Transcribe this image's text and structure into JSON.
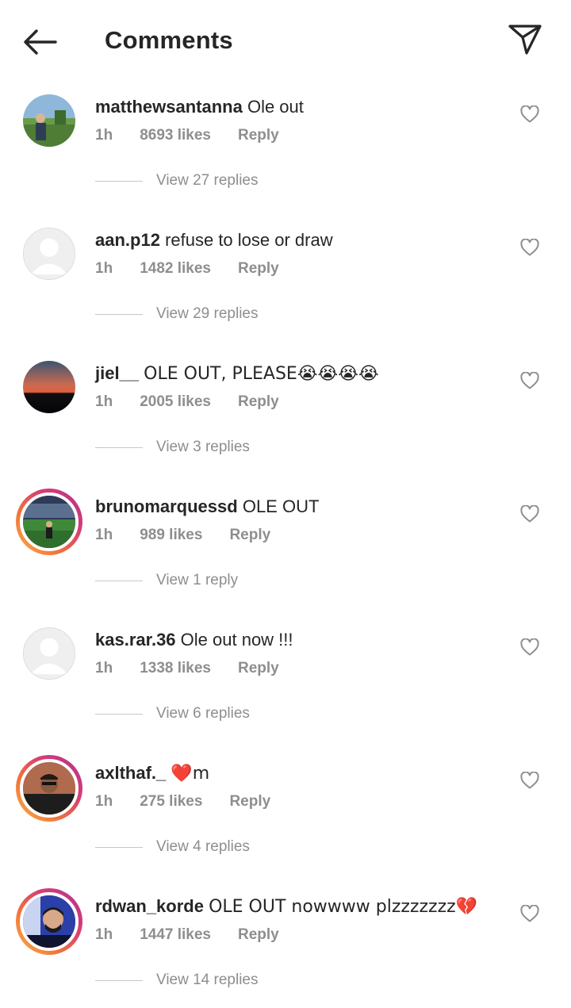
{
  "header": {
    "title": "Comments",
    "back_icon": "arrow-left-icon",
    "send_icon": "send-icon"
  },
  "comments": [
    {
      "username": "matthewsantanna",
      "text": "Ole out",
      "time": "1h",
      "likes": "8693 likes",
      "reply": "Reply",
      "view_replies": "View 27 replies",
      "avatar": "photo"
    },
    {
      "username": "aan.p12",
      "text": "refuse to lose or draw",
      "time": "1h",
      "likes": "1482 likes",
      "reply": "Reply",
      "view_replies": "View 29 replies",
      "avatar": "default"
    },
    {
      "username": "jiel__",
      "text": "OLE OUT, PLEASE😭😭😭😭",
      "time": "1h",
      "likes": "2005 likes",
      "reply": "Reply",
      "view_replies": "View 3 replies",
      "avatar": "photo"
    },
    {
      "username": "brunomarquessd",
      "text": "OLE OUT",
      "time": "1h",
      "likes": "989 likes",
      "reply": "Reply",
      "view_replies": "View 1 reply",
      "avatar": "story"
    },
    {
      "username": "kas.rar.36",
      "text": "Ole out now !!!",
      "time": "1h",
      "likes": "1338 likes",
      "reply": "Reply",
      "view_replies": "View 6 replies",
      "avatar": "default"
    },
    {
      "username": "axlthaf._",
      "text": "❤️m",
      "time": "1h",
      "likes": "275 likes",
      "reply": "Reply",
      "view_replies": "View 4 replies",
      "avatar": "story"
    },
    {
      "username": "rdwan_korde",
      "text": "OLE OUT nowwww plzzzzzzz💔",
      "time": "1h",
      "likes": "1447 likes",
      "reply": "Reply",
      "view_replies": "View 14 replies",
      "avatar": "story"
    }
  ],
  "colors": {
    "text": "#262626",
    "muted": "#8e8e8e",
    "story_gradient": [
      "#f9b24a",
      "#d73f72",
      "#b3318f"
    ]
  }
}
